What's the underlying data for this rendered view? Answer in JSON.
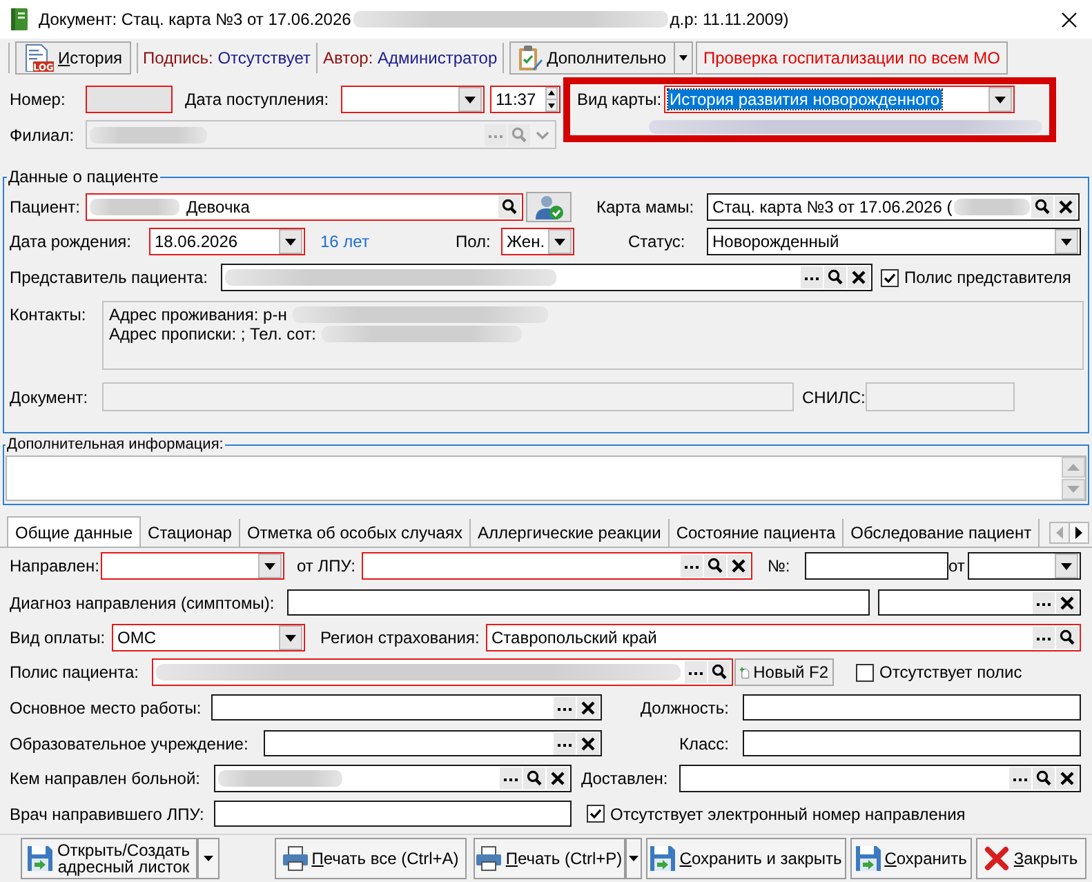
{
  "window": {
    "title": "Документ: Стац. карта №3 от 17.06.2026",
    "title_redacted": true,
    "title_end": "д.р: 11.11.2009)"
  },
  "toolbar": {
    "history": {
      "label": "История",
      "icon_text": "LOG",
      "mnemonic": true
    },
    "signature": {
      "label": "Подпись:",
      "value": "Отсутствует"
    },
    "author": {
      "label": "Автор:",
      "value": "Администратор"
    },
    "more": {
      "label": "Дополнительно"
    },
    "check_hospitalization": {
      "label": "Проверка госпитализации по всем МО"
    }
  },
  "header": {
    "number": {
      "label": "Номер:",
      "required": true,
      "disabled": true
    },
    "admission_date": {
      "label": "Дата поступления:",
      "required": true,
      "disabled": false
    },
    "admission_time": {
      "value": "11:37",
      "required": true,
      "disabled": false
    },
    "card_type": {
      "label": "Вид карты:",
      "value": "История развития новорожденного",
      "required": true,
      "disabled": false,
      "highlighted": true,
      "framed": true
    },
    "branch": {
      "label": "Филиал:",
      "redacted": true,
      "required": false,
      "disabled": true
    },
    "attachment_note": {
      "redacted": true
    }
  },
  "patient": {
    "title": "Данные о пациенте",
    "patient": {
      "label": "Пациент:",
      "value": "Девочка",
      "redacted": true,
      "required": true,
      "disabled": false
    },
    "mother_card": {
      "label": "Карта мамы:",
      "value": "Стац. карта №3 от 17.06.2026 (",
      "redacted": true,
      "required": false,
      "disabled": false
    },
    "birth_date": {
      "label": "Дата рождения:",
      "value": "18.06.2026",
      "required": true,
      "disabled": false
    },
    "age": "16 лет",
    "sex": {
      "label": "Пол:",
      "value": "Жен.",
      "required": true,
      "disabled": false
    },
    "status": {
      "label": "Статус:",
      "value": "Новорожденный",
      "required": false,
      "disabled": false
    },
    "representative": {
      "label": "Представитель пациента:",
      "redacted": true,
      "required": false,
      "disabled": false
    },
    "representative_policy": {
      "label": "Полис представителя",
      "checked": true
    },
    "contacts": {
      "label": "Контакты:",
      "disabled": true,
      "lines": [
        {
          "text": "Адрес проживания: р-н",
          "redacted": true
        },
        {
          "text": "Адрес прописки: ; Тел. сот:",
          "redacted": true
        }
      ]
    },
    "document": {
      "label": "Документ:",
      "required": false,
      "disabled": true
    },
    "snils": {
      "label": "СНИЛС:",
      "required": false,
      "disabled": true
    }
  },
  "additional_info": {
    "title": "Дополнительная информация:"
  },
  "tabs": [
    {
      "label": "Общие данные",
      "selected": true
    },
    {
      "label": "Стационар",
      "selected": false
    },
    {
      "label": "Отметка об особых случаях",
      "selected": false
    },
    {
      "label": "Аллергические реакции",
      "selected": false
    },
    {
      "label": "Состояние пациента",
      "selected": false
    },
    {
      "label": "Обследование пациент",
      "selected": false
    }
  ],
  "general": {
    "referred": {
      "label": "Направлен:",
      "required": true,
      "disabled": false
    },
    "from_lpu": {
      "label": "от ЛПУ:",
      "required": true,
      "disabled": false
    },
    "referral_number": {
      "label": "№:",
      "required": false,
      "disabled": false
    },
    "referral_date": {
      "label": "от",
      "required": false,
      "disabled": false
    },
    "diagnosis": {
      "label": "Диагноз направления (симптомы):",
      "required": false,
      "disabled": false
    },
    "diagnosis_code": {
      "required": false,
      "disabled": false
    },
    "payment": {
      "label": "Вид оплаты:",
      "value": "ОМС",
      "required": true,
      "disabled": false
    },
    "insurance_region": {
      "label": "Регион страхования:",
      "value": "Ставропольский край",
      "required": true,
      "disabled": false
    },
    "policy": {
      "label": "Полис пациента:",
      "redacted": true,
      "required": true,
      "disabled": false
    },
    "new_policy_button": {
      "label": "Новый F2"
    },
    "no_policy": {
      "label": "Отсутствует полис",
      "checked": false
    },
    "workplace": {
      "label": "Основное место работы:",
      "required": false,
      "disabled": false
    },
    "position": {
      "label": "Должность:",
      "required": false,
      "disabled": false
    },
    "school": {
      "label": "Образовательное учреждение:",
      "required": false,
      "disabled": false
    },
    "grade": {
      "label": "Класс:",
      "required": false,
      "disabled": false
    },
    "referred_by": {
      "label": "Кем направлен больной:",
      "redacted": true,
      "required": false,
      "disabled": false
    },
    "delivered": {
      "label": "Доставлен:",
      "required": false,
      "disabled": false
    },
    "referring_doctor": {
      "label": "Врач направившего ЛПУ:",
      "required": false,
      "disabled": false
    },
    "no_electronic_number": {
      "label": "Отсутствует электронный номер направления",
      "checked": true
    }
  },
  "buttons": {
    "address": {
      "label": "Открыть/Создать адресный листок",
      "mnemonic": false
    },
    "print_all": {
      "label": "Печать все (Ctrl+A)",
      "mnemonic": true
    },
    "print": {
      "label": "Печать (Ctrl+P)",
      "mnemonic": true
    },
    "save_close": {
      "label": "Сохранить и закрыть",
      "mnemonic": true
    },
    "save": {
      "label": "Сохранить",
      "mnemonic": true
    },
    "close": {
      "label": "Закрыть",
      "mnemonic": true
    }
  }
}
